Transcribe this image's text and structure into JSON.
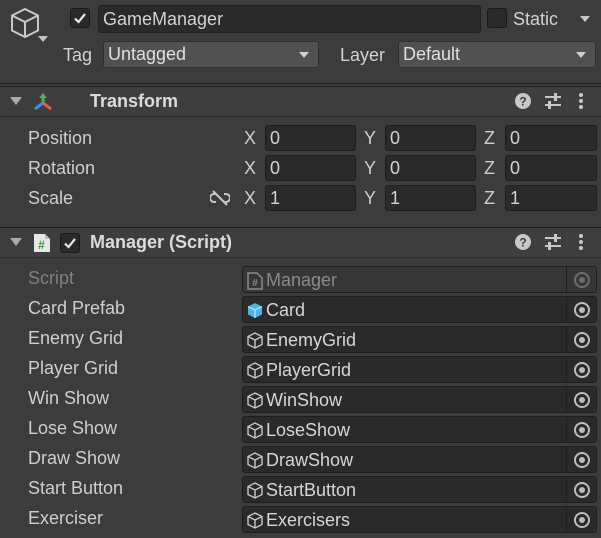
{
  "header": {
    "object_name": "GameManager",
    "active": true,
    "static_label": "Static",
    "tag_label": "Tag",
    "tag_value": "Untagged",
    "layer_label": "Layer",
    "layer_value": "Default"
  },
  "transform": {
    "title": "Transform",
    "rows": [
      {
        "label": "Position",
        "x": "0",
        "y": "0",
        "z": "0"
      },
      {
        "label": "Rotation",
        "x": "0",
        "y": "0",
        "z": "0"
      },
      {
        "label": "Scale",
        "x": "1",
        "y": "1",
        "z": "1"
      }
    ],
    "axis": {
      "x": "X",
      "y": "Y",
      "z": "Z"
    }
  },
  "manager": {
    "title": "Manager (Script)",
    "enabled": true,
    "fields": [
      {
        "label": "Script",
        "value": "Manager",
        "icon": "script-icon",
        "disabled": true
      },
      {
        "label": "Card Prefab",
        "value": "Card",
        "icon": "prefab-cube-icon",
        "disabled": false
      },
      {
        "label": "Enemy Grid",
        "value": "EnemyGrid",
        "icon": "gameobject-icon",
        "disabled": false
      },
      {
        "label": "Player Grid",
        "value": "PlayerGrid",
        "icon": "gameobject-icon",
        "disabled": false
      },
      {
        "label": "Win Show",
        "value": "WinShow",
        "icon": "gameobject-icon",
        "disabled": false
      },
      {
        "label": "Lose Show",
        "value": "LoseShow",
        "icon": "gameobject-icon",
        "disabled": false
      },
      {
        "label": "Draw Show",
        "value": "DrawShow",
        "icon": "gameobject-icon",
        "disabled": false
      },
      {
        "label": "Start Button",
        "value": "StartButton",
        "icon": "gameobject-icon",
        "disabled": false
      },
      {
        "label": "Exerciser",
        "value": "Exercisers",
        "icon": "gameobject-icon",
        "disabled": false
      }
    ]
  },
  "colors": {
    "background": "#3c3c3c",
    "field": "#2a2a2a",
    "prefab_blue": "#4fb3e8"
  }
}
